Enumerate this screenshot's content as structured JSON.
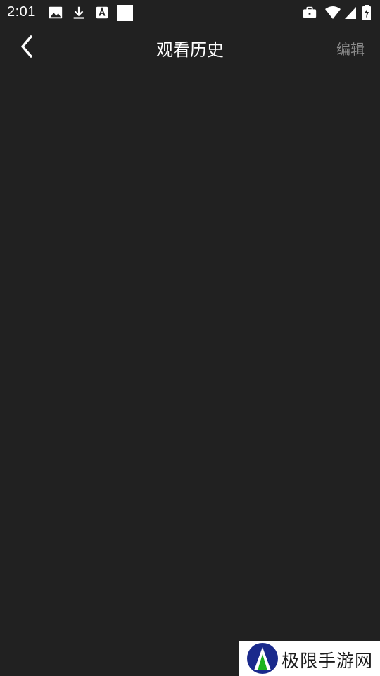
{
  "status_bar": {
    "time": "2:01",
    "left_icons": [
      "image-icon",
      "download-icon",
      "font-a-icon",
      "white-square"
    ],
    "right_icons": [
      "briefcase-icon",
      "wifi-icon",
      "signal-icon",
      "battery-charging-icon"
    ]
  },
  "app_bar": {
    "title": "观看历史",
    "edit_label": "编辑",
    "back_icon": "chevron-left-icon"
  },
  "watermark": {
    "text": "极限手游网"
  },
  "colors": {
    "background": "#212121",
    "title_text": "#ffffff",
    "edit_text": "#8a8a8a"
  }
}
